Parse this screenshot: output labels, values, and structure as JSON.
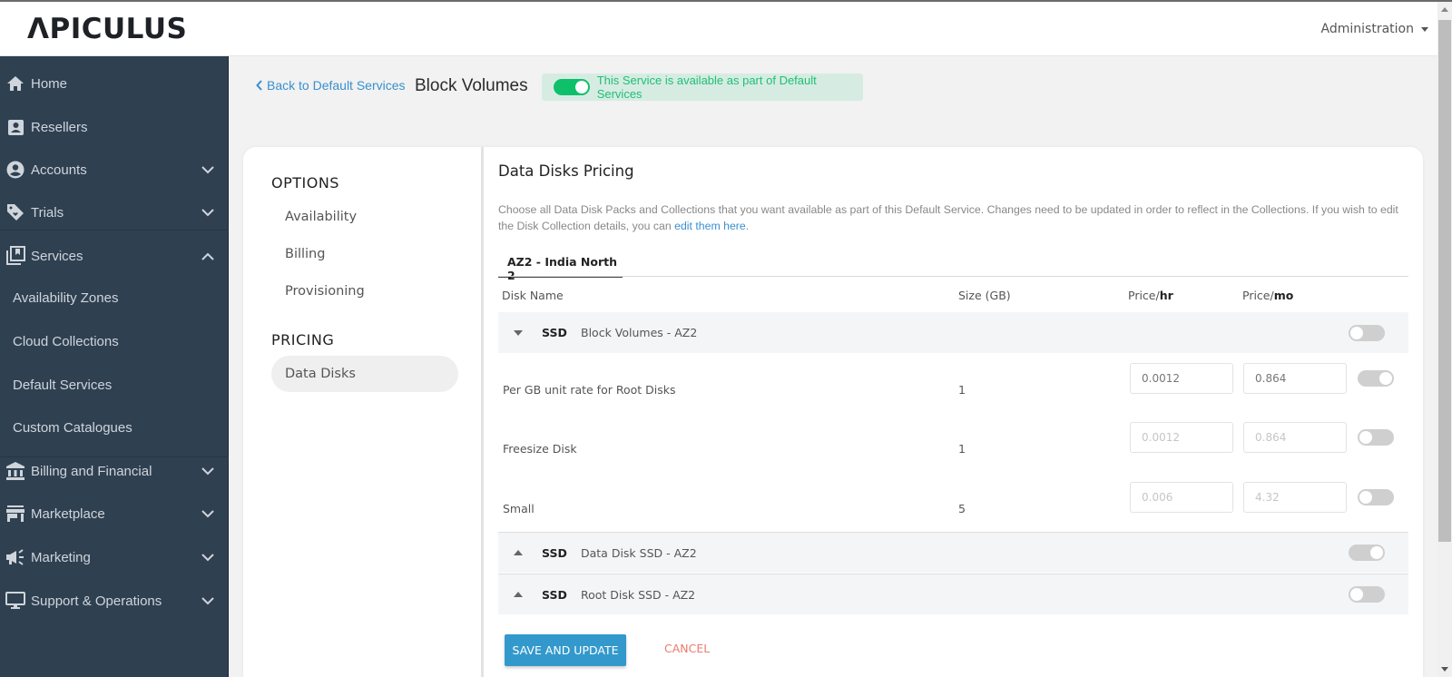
{
  "header": {
    "logo": "ΛPICULUS",
    "admin_menu": "Administration"
  },
  "sidebar": {
    "items": [
      {
        "label": "Home",
        "icon": "home-icon"
      },
      {
        "label": "Resellers",
        "icon": "contact-card-icon"
      },
      {
        "label": "Accounts",
        "icon": "account-circle-icon",
        "expandable": true,
        "expanded": false
      },
      {
        "label": "Trials",
        "icon": "tag-icon",
        "expandable": true,
        "expanded": false
      },
      {
        "label": "Services",
        "icon": "library-icon",
        "expandable": true,
        "expanded": true
      },
      {
        "label": "Billing and Financial",
        "icon": "bank-icon",
        "expandable": true,
        "expanded": false
      },
      {
        "label": "Marketplace",
        "icon": "store-icon",
        "expandable": true,
        "expanded": false
      },
      {
        "label": "Marketing",
        "icon": "megaphone-icon",
        "expandable": true,
        "expanded": false
      },
      {
        "label": "Support & Operations",
        "icon": "monitor-icon",
        "expandable": true,
        "expanded": false
      }
    ],
    "services_sub": [
      {
        "label": "Availability Zones"
      },
      {
        "label": "Cloud Collections"
      },
      {
        "label": "Default Services"
      },
      {
        "label": "Custom Catalogues"
      }
    ]
  },
  "page": {
    "back_link": "Back to Default Services",
    "title": "Block Volumes",
    "availability_text": "This Service is available as part of Default Services",
    "availability_enabled": true
  },
  "options": {
    "heading": "OPTIONS",
    "items": [
      "Availability",
      "Billing",
      "Provisioning"
    ],
    "pricing_heading": "PRICING",
    "pricing_items": [
      "Data Disks"
    ],
    "active": "Data Disks"
  },
  "pricing": {
    "title": "Data Disks Pricing",
    "description": "Choose all Data Disk Packs and Collections that you want available as part of this Default Service. Changes need to be updated in order to reflect in the Collections. If you wish to edit the Disk Collection details, you can ",
    "description_link": "edit them here",
    "description_end": ".",
    "tab": "AZ2 - India North 2",
    "columns": {
      "disk_name": "Disk Name",
      "size": "Size (GB)",
      "price_hr_prefix": "Price/",
      "price_hr_unit": "hr",
      "price_mo_prefix": "Price/",
      "price_mo_unit": "mo"
    },
    "groups": [
      {
        "type": "SSD",
        "name": "Block Volumes - AZ2",
        "expanded": true,
        "enabled": false,
        "disks": [
          {
            "name": "Per GB unit rate for Root Disks",
            "size": "1",
            "price_hr": "0.0012",
            "price_mo": "0.864",
            "enabled": true
          },
          {
            "name": "Freesize Disk",
            "size": "1",
            "price_hr": "0.0012",
            "price_mo": "0.864",
            "enabled": false
          },
          {
            "name": "Small",
            "size": "5",
            "price_hr": "0.006",
            "price_mo": "4.32",
            "enabled": false
          }
        ]
      },
      {
        "type": "SSD",
        "name": "Data Disk SSD - AZ2",
        "expanded": false,
        "enabled": true
      },
      {
        "type": "SSD",
        "name": "Root Disk SSD - AZ2",
        "expanded": false,
        "enabled": false
      }
    ],
    "save_label": "SAVE AND UPDATE",
    "cancel_label": "CANCEL"
  },
  "colors": {
    "sidebar_bg": "#2f4051",
    "accent_blue": "#3399cc",
    "success_green": "#0fc06b",
    "cancel_red": "#e97b6e"
  }
}
